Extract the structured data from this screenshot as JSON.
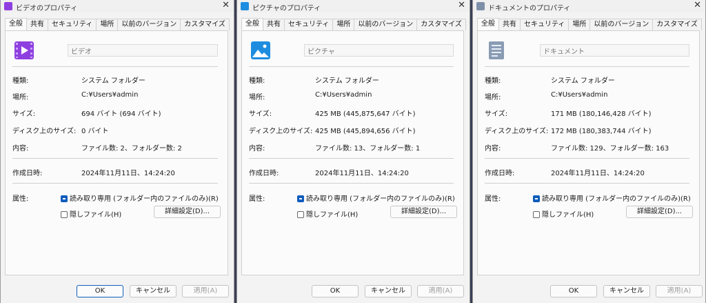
{
  "tabs": [
    "全般",
    "共有",
    "セキュリティ",
    "場所",
    "以前のバージョン",
    "カスタマイズ"
  ],
  "labels": {
    "type": "種類:",
    "location": "場所:",
    "size": "サイズ:",
    "size_on_disk": "ディスク上のサイズ:",
    "contents": "内容:",
    "created": "作成日時:",
    "attributes": "属性:"
  },
  "attributes": {
    "readonly": "読み取り専用 (フォルダー内のファイルのみ)(R)",
    "hidden": "隠しファイル(H)",
    "advanced": "詳細設定(D)..."
  },
  "buttons": {
    "ok": "OK",
    "cancel": "キャンセル",
    "apply": "適用(A)"
  },
  "colors": {
    "video_icon": "#8e3fe0",
    "picture_icon": "#1e8de0",
    "document_icon": "#7e8fa8",
    "accent": "#0f5dbd"
  },
  "windows": [
    {
      "title": "ビデオのプロパティ",
      "icon": "video-folder-icon",
      "name": "ビデオ",
      "type": "システム フォルダー",
      "location": "C:¥Users¥admin",
      "size": "694 バイト (694 バイト)",
      "size_on_disk": "0 バイト",
      "contents": "ファイル数: 2、フォルダー数: 2",
      "created": "2024年11月11日、14:24:20"
    },
    {
      "title": "ピクチャのプロパティ",
      "icon": "picture-folder-icon",
      "name": "ピクチャ",
      "type": "システム フォルダー",
      "location": "C:¥Users¥admin",
      "size": "425 MB (445,875,647 バイト)",
      "size_on_disk": "425 MB (445,894,656 バイト)",
      "contents": "ファイル数: 13、フォルダー数: 1",
      "created": "2024年11月11日、14:24:20"
    },
    {
      "title": "ドキュメントのプロパティ",
      "icon": "document-folder-icon",
      "name": "ドキュメント",
      "type": "システム フォルダー",
      "location": "C:¥Users¥admin",
      "size": "171 MB (180,146,428 バイト)",
      "size_on_disk": "172 MB (180,383,744 バイト)",
      "contents": "ファイル数: 129、フォルダー数: 163",
      "created": "2024年11月11日、14:24:20"
    }
  ]
}
